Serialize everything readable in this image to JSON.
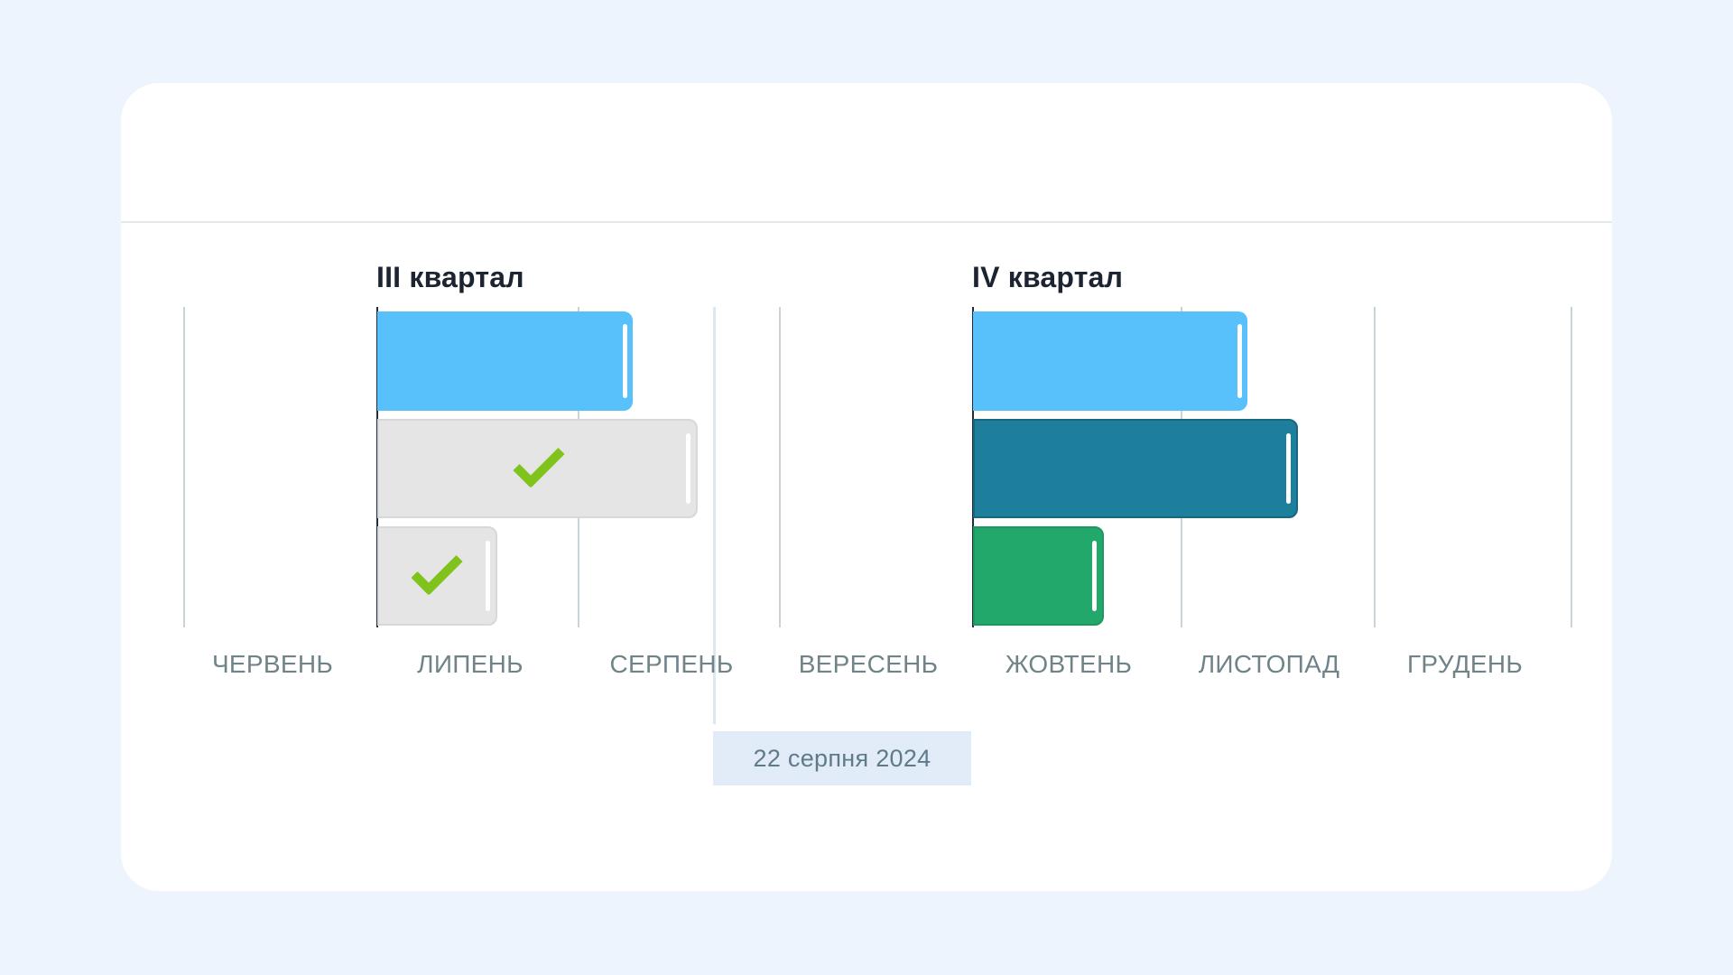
{
  "quarters": [
    {
      "title": "III квартал"
    },
    {
      "title": "IV квартал"
    }
  ],
  "months": [
    "ЧЕРВЕНЬ",
    "ЛИПЕНЬ",
    "СЕРПЕНЬ",
    "ВЕРЕСЕНЬ",
    "ЖОВТЕНЬ",
    "ЛИСТОПАД",
    "ГРУДЕНЬ"
  ],
  "today": {
    "label": "22 серпня 2024"
  },
  "tasks": {
    "q3": [
      {
        "status": "active",
        "color": "#58c0fb",
        "completed": false
      },
      {
        "status": "done",
        "color": "#e5e5e5",
        "completed": true,
        "check_icon": "check-icon"
      },
      {
        "status": "done",
        "color": "#e5e5e5",
        "completed": true,
        "check_icon": "check-icon"
      }
    ],
    "q4": [
      {
        "status": "active",
        "color": "#58c0fb",
        "completed": false
      },
      {
        "status": "active",
        "color": "#1e7f9c",
        "completed": false
      },
      {
        "status": "active",
        "color": "#22a86b",
        "completed": false
      }
    ]
  },
  "colors": {
    "accent_blue": "#58c0fb",
    "accent_teal": "#1e7f9c",
    "accent_green": "#22a86b",
    "check_green": "#7fc31c",
    "background": "#eef4fd"
  }
}
